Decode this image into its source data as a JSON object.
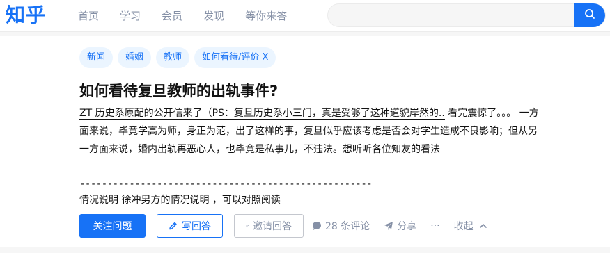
{
  "header": {
    "logo": "知乎",
    "nav": [
      "首页",
      "学习",
      "会员",
      "发现",
      "等你来答"
    ],
    "search": {
      "value": "",
      "placeholder": ""
    }
  },
  "question": {
    "tags": [
      "新闻",
      "婚姻",
      "教师",
      "如何看待/评价 X"
    ],
    "title": "如何看待复旦教师的出轨事件?",
    "detail_link": "ZT 历史系原配的公开信来了（PS：复旦历史系小三门，真是受够了这种道貌岸然的..",
    "detail_rest": " 看完震惊了。。。 一方面来说，毕竟学高为师，身正为范，出了这样的事，复旦似乎应该考虑是否会对学生造成不良影响；但从另一方面来说，婚内出轨再恶心人，也毕竟是私事儿，不违法。想听听各位知友的看法",
    "separator": "-------------------------------------------------------------",
    "ref_link1": "情况说明",
    "ref_link2": "徐冲",
    "ref_rest": "男方的情况说明 ，可以对照阅读"
  },
  "actions": {
    "follow": "关注问题",
    "write": "写回答",
    "invite": "邀请回答",
    "comments": "28 条评论",
    "share": "分享",
    "more": "···",
    "collapse": "收起"
  },
  "colors": {
    "brand": "#1772f6",
    "tag_bg": "#ebf5ff",
    "muted": "#8590a6"
  }
}
